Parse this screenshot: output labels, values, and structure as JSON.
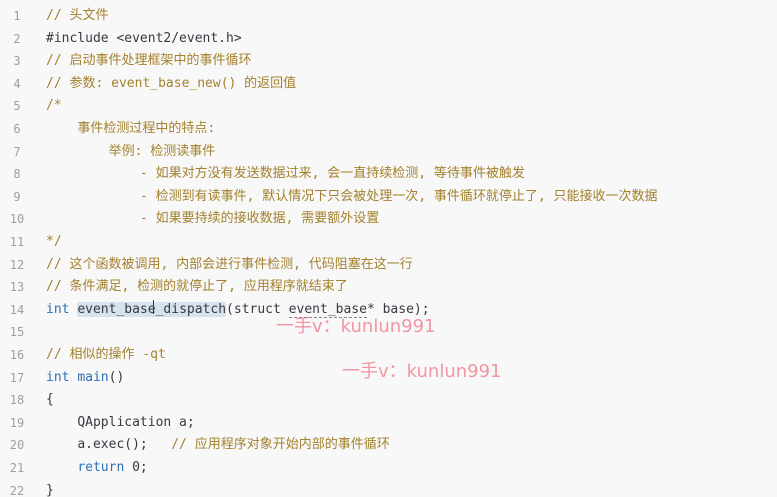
{
  "lines": [
    {
      "num": "1",
      "indent": "",
      "parts": [
        {
          "cls": "comment",
          "text": "// 头文件"
        }
      ]
    },
    {
      "num": "2",
      "indent": "",
      "parts": [
        {
          "cls": "plain",
          "text": "#include <event2/event.h>"
        }
      ]
    },
    {
      "num": "3",
      "indent": "",
      "parts": [
        {
          "cls": "comment",
          "text": "// 启动事件处理框架中的事件循环"
        }
      ]
    },
    {
      "num": "4",
      "indent": "",
      "parts": [
        {
          "cls": "comment",
          "text": "// 参数: event_base_new() 的返回值"
        }
      ]
    },
    {
      "num": "5",
      "indent": "",
      "parts": [
        {
          "cls": "comment",
          "text": "/*"
        }
      ]
    },
    {
      "num": "6",
      "indent": "    ",
      "parts": [
        {
          "cls": "comment",
          "text": "事件检测过程中的特点:"
        }
      ]
    },
    {
      "num": "7",
      "indent": "        ",
      "parts": [
        {
          "cls": "comment",
          "text": "举例: 检测读事件"
        }
      ]
    },
    {
      "num": "8",
      "indent": "            ",
      "parts": [
        {
          "cls": "comment",
          "text": "- 如果对方没有发送数据过来, 会一直持续检测, 等待事件被触发"
        }
      ]
    },
    {
      "num": "9",
      "indent": "            ",
      "parts": [
        {
          "cls": "comment",
          "text": "- 检测到有读事件, 默认情况下只会被处理一次, 事件循环就停止了, 只能接收一次数据"
        }
      ]
    },
    {
      "num": "10",
      "indent": "            ",
      "parts": [
        {
          "cls": "comment",
          "text": "- 如果要持续的接收数据, 需要额外设置"
        }
      ]
    },
    {
      "num": "11",
      "indent": "",
      "parts": [
        {
          "cls": "comment",
          "text": "*/"
        }
      ]
    },
    {
      "num": "12",
      "indent": "",
      "parts": [
        {
          "cls": "comment",
          "text": "// 这个函数被调用, 内部会进行事件检测, 代码阻塞在这一行"
        }
      ]
    },
    {
      "num": "13",
      "indent": "",
      "parts": [
        {
          "cls": "comment",
          "text": "// 条件满足, 检测的就停止了, 应用程序就结束了"
        }
      ]
    },
    {
      "num": "14",
      "indent": "",
      "parts": [
        {
          "cls": "kw",
          "text": "int "
        },
        {
          "cls": "plain sel",
          "text": "event_base_dispatch"
        },
        {
          "cls": "plain",
          "text": "(struct "
        },
        {
          "cls": "plain underline-dash",
          "text": "event_base"
        },
        {
          "cls": "plain",
          "text": "* base);"
        }
      ]
    },
    {
      "num": "15",
      "indent": "",
      "parts": []
    },
    {
      "num": "16",
      "indent": "",
      "parts": [
        {
          "cls": "comment",
          "text": "// 相似的操作 -qt"
        }
      ]
    },
    {
      "num": "17",
      "indent": "",
      "parts": [
        {
          "cls": "kw",
          "text": "int "
        },
        {
          "cls": "kw",
          "text": "main"
        },
        {
          "cls": "plain",
          "text": "()"
        }
      ]
    },
    {
      "num": "18",
      "indent": "",
      "parts": [
        {
          "cls": "plain",
          "text": "{"
        }
      ]
    },
    {
      "num": "19",
      "indent": "    ",
      "parts": [
        {
          "cls": "plain",
          "text": "QApplication a;"
        }
      ]
    },
    {
      "num": "20",
      "indent": "    ",
      "parts": [
        {
          "cls": "plain",
          "text": "a.exec();   "
        },
        {
          "cls": "comment",
          "text": "// 应用程序对象开始内部的事件循环"
        }
      ]
    },
    {
      "num": "21",
      "indent": "    ",
      "parts": [
        {
          "cls": "kw",
          "text": "return "
        },
        {
          "cls": "plain",
          "text": "0;"
        }
      ]
    },
    {
      "num": "22",
      "indent": "",
      "parts": [
        {
          "cls": "plain",
          "text": "}"
        }
      ]
    }
  ],
  "watermarks": [
    {
      "text": "一手v：kunlun991"
    },
    {
      "text": "一手v：kunlun991"
    }
  ],
  "colors": {
    "background": "#f8f8f8",
    "comment": "#a3812d",
    "keyword": "#2d6fb5",
    "selection": "#d6e2ee",
    "watermark": "#eb465a"
  }
}
